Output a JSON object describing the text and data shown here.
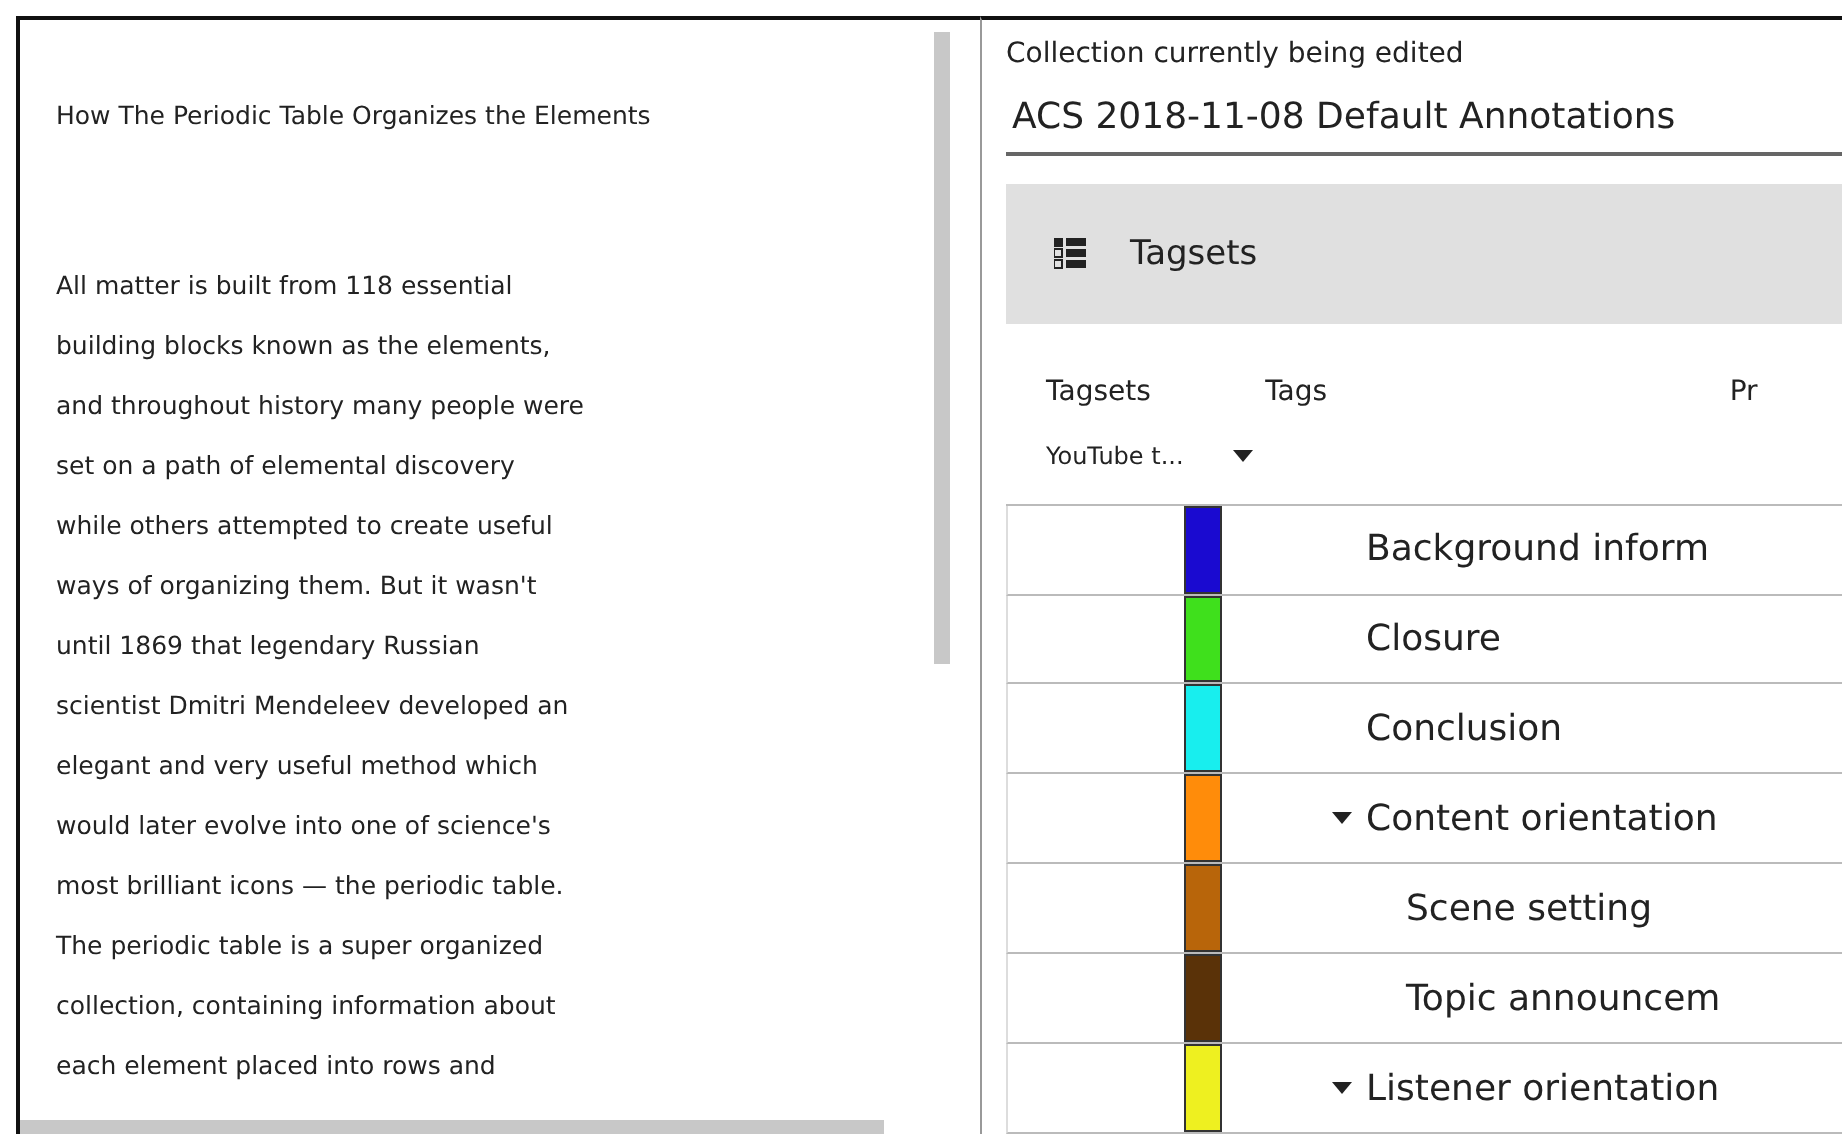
{
  "document": {
    "title": "How The Periodic Table Organizes the Elements",
    "lines": [
      "All matter is built from 118 essential",
      "building blocks known as the elements,",
      "and throughout history many people were",
      "set on a path of elemental discovery",
      "while others attempted to create useful",
      "ways of organizing them. But it wasn't",
      "until 1869 that legendary Russian",
      "scientist Dmitri Mendeleev developed an",
      "elegant and very useful method which",
      "would later evolve into one of science's",
      "most brilliant icons — the periodic table.",
      "The periodic table is a super organized",
      "collection, containing information about",
      "each element placed into rows and"
    ]
  },
  "collection": {
    "label": "Collection currently being edited",
    "value": "ACS 2018-11-08 Default Annotations"
  },
  "tagsets_panel": {
    "title": "Tagsets",
    "columns": [
      "Tagsets",
      "Tags",
      "Pr"
    ],
    "tagset_select": "YouTube t...",
    "tags": [
      {
        "name": "Background inform",
        "color": "#1a0ad0"
      },
      {
        "name": "Closure",
        "color": "#3fe01c"
      },
      {
        "name": "Conclusion",
        "color": "#18eeee"
      },
      {
        "name": "Content orientation",
        "color": "#ff8c0a",
        "expanded": true,
        "children": [
          {
            "name": "Scene setting",
            "color": "#b8650a"
          },
          {
            "name": "Topic announcem",
            "color": "#5a3208"
          }
        ]
      },
      {
        "name": "Listener orientation",
        "color": "#eef020",
        "expanded": true
      }
    ]
  }
}
